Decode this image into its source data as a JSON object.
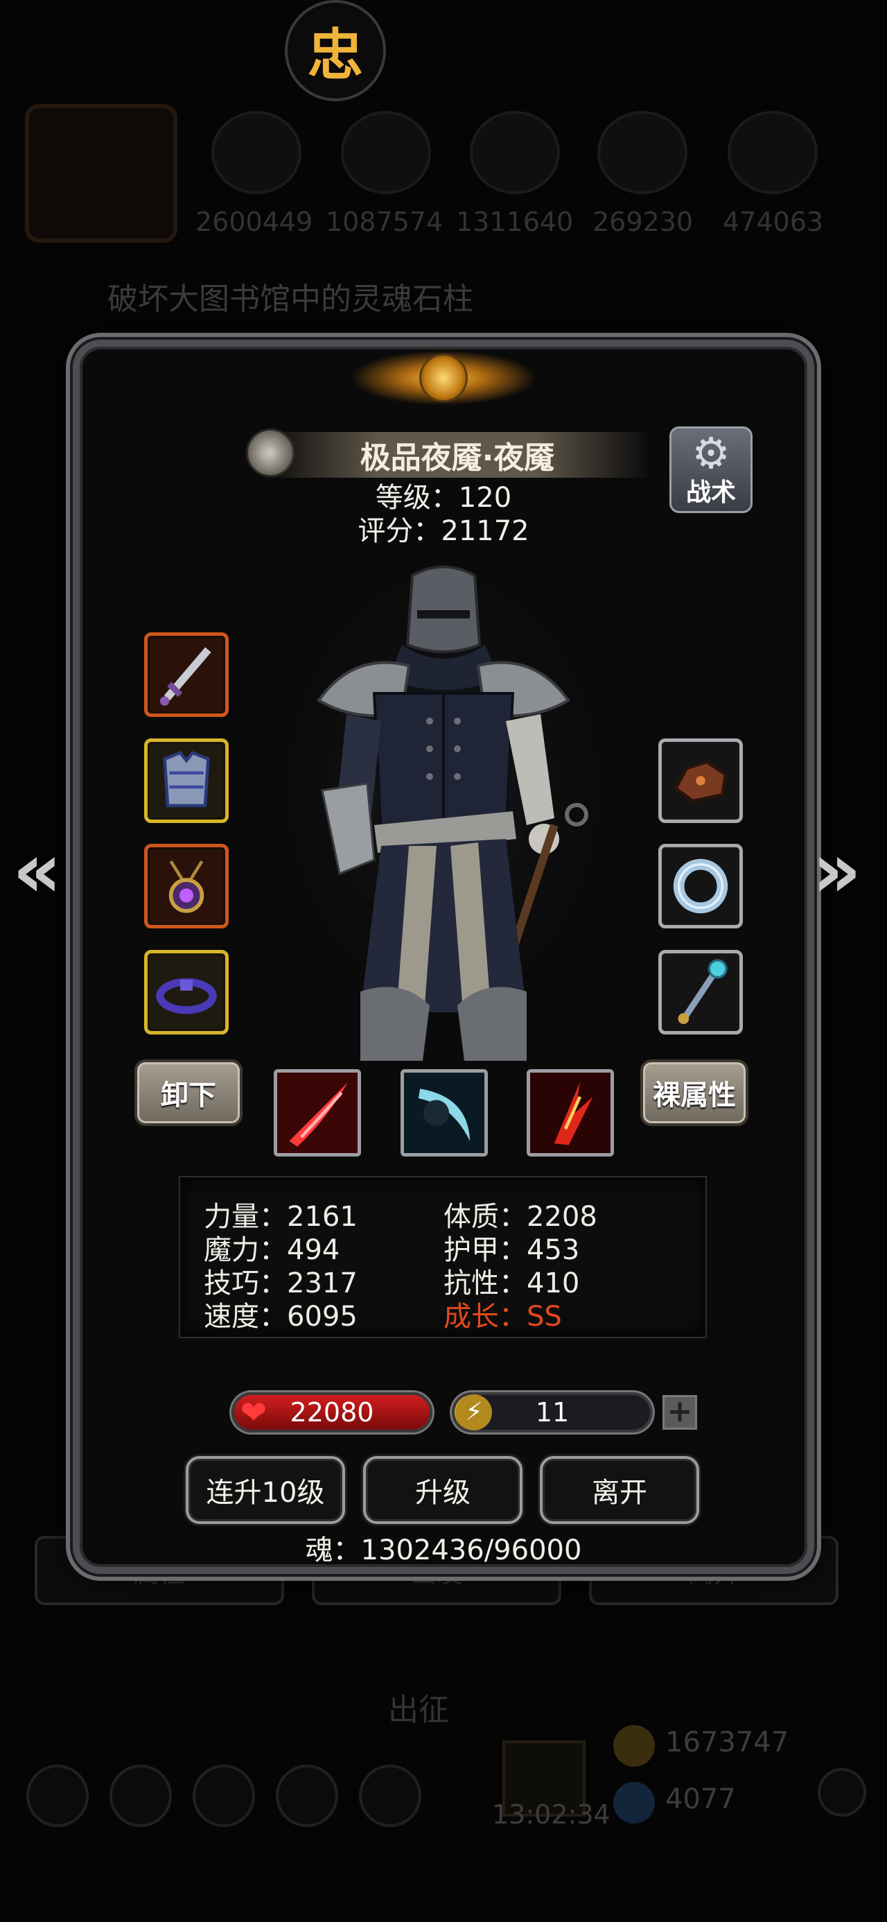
{
  "top_badge": {
    "glyph": "忠"
  },
  "background": {
    "resources": [
      "2600449",
      "1087574",
      "1311640",
      "269230",
      "474063"
    ],
    "quest_text": "破坏大图书馆中的灵魂石柱",
    "buttons": [
      "属性",
      "出发",
      "离开"
    ],
    "go_label": "出征",
    "timer": "13:02:34",
    "gold": "1673747",
    "gems": "4077"
  },
  "hero": {
    "name": "极品夜魇·夜魇",
    "level_text": "等级：120",
    "score_text": "评分：21172",
    "tactic_label": "战术"
  },
  "equipment": {
    "left": [
      "dagger-icon",
      "chest-armor-icon",
      "amulet-icon",
      "bracelet-icon"
    ],
    "right": [
      "ore-icon",
      "ring-icon",
      "scepter-icon"
    ]
  },
  "buttons": {
    "unequip": "卸下",
    "naked_stats": "裸属性",
    "level_up_10": "连升10级",
    "level_up": "升级",
    "leave": "离开"
  },
  "skills": [
    "slash-red-icon",
    "slash-frost-icon",
    "claw-fire-icon"
  ],
  "stats": {
    "strength": "力量：2161",
    "magic": "魔力：494",
    "skill": "技巧：2317",
    "speed": "速度：6095",
    "constitution": "体质：2208",
    "armor": "护甲：453",
    "resistance": "抗性：410",
    "growth": "成长：SS"
  },
  "bars": {
    "hp": "22080",
    "energy": "11",
    "energy_fill_fraction": 0.12,
    "plus": "+"
  },
  "soul_text": "魂：1302436/96000",
  "colors": {
    "growth": "#e24a1f",
    "hp": "#d21e1e",
    "energy": "#f0c040",
    "frame": "#4d4d52"
  }
}
